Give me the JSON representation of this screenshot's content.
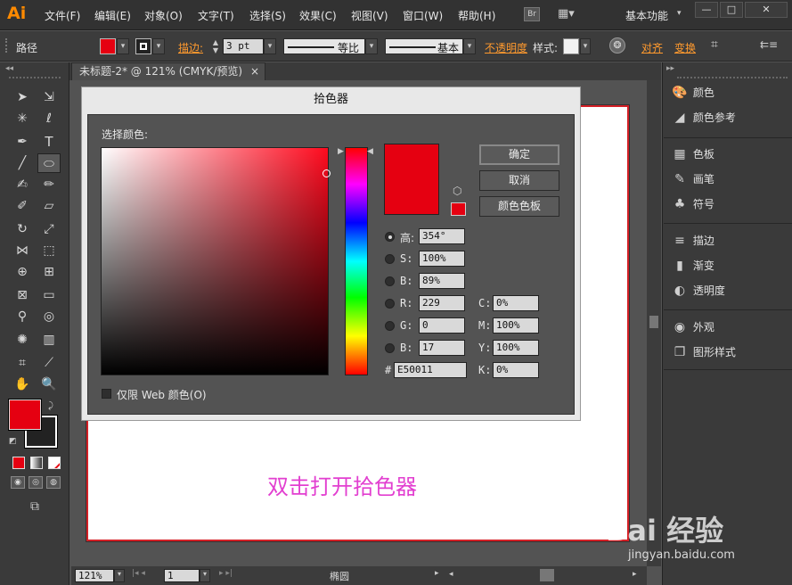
{
  "app": {
    "logo": "Ai"
  },
  "menu": [
    "文件(F)",
    "编辑(E)",
    "对象(O)",
    "文字(T)",
    "选择(S)",
    "效果(C)",
    "视图(V)",
    "窗口(W)",
    "帮助(H)"
  ],
  "bridge_label": "Br",
  "workspace": "基本功能",
  "window_buttons": [
    "—",
    "□",
    "✕"
  ],
  "control": {
    "selection": "路径",
    "stroke_label": "描边:",
    "stroke_width": "3 pt",
    "profile": "等比",
    "brush": "基本",
    "opacity_label": "不透明度",
    "style_label": "样式:",
    "align_label": "对齐",
    "transform_label": "变换"
  },
  "document": {
    "tab_title": "未标题-2* @ 121% (CMYK/预览)",
    "tab_close": "×",
    "annotation": "双击打开拾色器"
  },
  "status": {
    "zoom": "121%",
    "page": "1",
    "tool_name": "椭圆"
  },
  "color_picker": {
    "title": "拾色器",
    "select_color_label": "选择颜色:",
    "ok_label": "确定",
    "cancel_label": "取消",
    "swatches_label": "颜色色板",
    "web_only_label": "仅限 Web 颜色(O)",
    "new_color": "#e50011",
    "hsb": [
      {
        "label": "H:",
        "display_label": "高:",
        "value": "354°"
      },
      {
        "label": "S:",
        "value": "100%"
      },
      {
        "label": "B:",
        "value": "89%"
      }
    ],
    "rgb": [
      {
        "label": "R:",
        "value": "229"
      },
      {
        "label": "G:",
        "value": "0"
      },
      {
        "label": "B:",
        "value": "17"
      }
    ],
    "cmyk": [
      {
        "label": "C:",
        "value": "0%"
      },
      {
        "label": "M:",
        "value": "100%"
      },
      {
        "label": "Y:",
        "value": "100%"
      },
      {
        "label": "K:",
        "value": "0%"
      }
    ],
    "hex_label": "#",
    "hex": "E50011"
  },
  "panels": [
    {
      "icon": "palette-icon",
      "glyph": "🎨",
      "label": "颜色"
    },
    {
      "icon": "color-guide-icon",
      "glyph": "◢",
      "label": "颜色参考"
    },
    {
      "icon": "swatches-icon",
      "glyph": "▦",
      "label": "色板"
    },
    {
      "icon": "brushes-icon",
      "glyph": "✎",
      "label": "画笔"
    },
    {
      "icon": "symbols-icon",
      "glyph": "♣",
      "label": "符号"
    },
    {
      "icon": "stroke-icon",
      "glyph": "≡",
      "label": "描边"
    },
    {
      "icon": "gradient-icon",
      "glyph": "▮",
      "label": "渐变"
    },
    {
      "icon": "transparency-icon",
      "glyph": "◐",
      "label": "透明度"
    },
    {
      "icon": "appearance-icon",
      "glyph": "◉",
      "label": "外观"
    },
    {
      "icon": "graphic-styles-icon",
      "glyph": "❐",
      "label": "图形样式"
    }
  ],
  "colors": {
    "fill": "#e50011",
    "accent": "#ff9a2e",
    "artboard_border": "#d42026"
  },
  "watermark": {
    "logo": "Bai 经验",
    "url": "jingyan.baidu.com"
  }
}
